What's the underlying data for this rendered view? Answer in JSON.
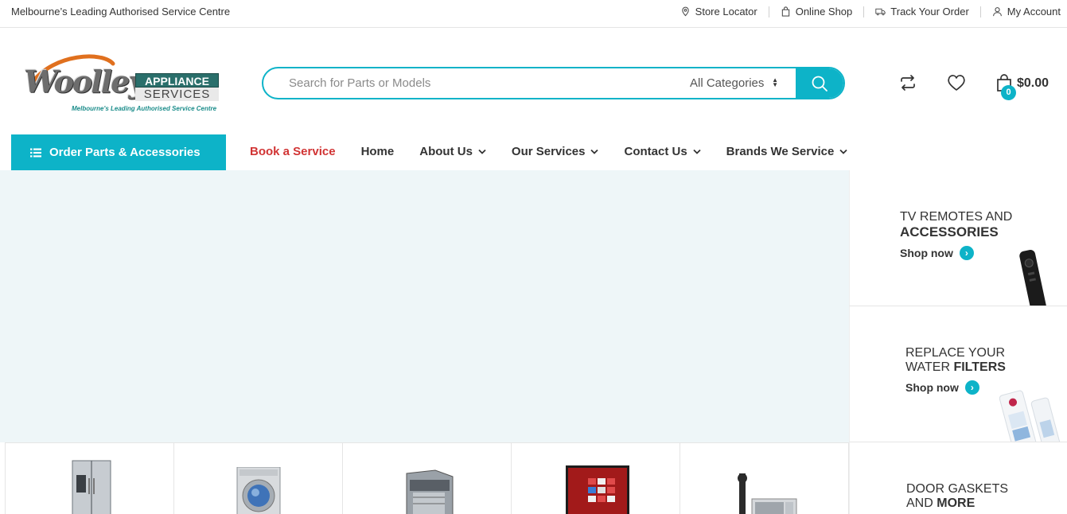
{
  "topbar": {
    "tagline": "Melbourne’s Leading Authorised Service Centre",
    "links": [
      {
        "label": "Store Locator",
        "icon": "location-pin-icon"
      },
      {
        "label": "Online Shop",
        "icon": "shopping-bag-icon"
      },
      {
        "label": "Track Your Order",
        "icon": "truck-icon"
      },
      {
        "label": "My Account",
        "icon": "user-icon"
      }
    ]
  },
  "logo": {
    "word": "Woolley",
    "badge1": "APPLIANCE",
    "badge2": "SERVICES",
    "sub": "Melbourne's Leading Authorised Service Centre"
  },
  "search": {
    "placeholder": "Search for Parts or Models",
    "category": "All Categories"
  },
  "header": {
    "cart_count": "0",
    "cart_total": "$0.00"
  },
  "nav": {
    "category_button": "Order Parts & Accessories",
    "items": [
      {
        "label": "Book a Service",
        "dropdown": false
      },
      {
        "label": "Home",
        "dropdown": false
      },
      {
        "label": "About Us",
        "dropdown": true
      },
      {
        "label": "Our Services",
        "dropdown": true
      },
      {
        "label": "Contact Us",
        "dropdown": true
      },
      {
        "label": "Brands We Service",
        "dropdown": true
      }
    ]
  },
  "promos": [
    {
      "line1": "TV REMOTES AND",
      "line2": "ACCESSORIES",
      "cta": "Shop now"
    },
    {
      "line1": "REPLACE YOUR",
      "line2a": "WATER ",
      "line2b": "FILTERS",
      "cta": "Shop now"
    },
    {
      "line1": "DOOR GASKETS",
      "line2a": "AND ",
      "line2b": "MORE"
    }
  ],
  "colors": {
    "accent": "#0db3c8",
    "nav_red": "#d13434",
    "hero_bg": "#eef6f8"
  }
}
